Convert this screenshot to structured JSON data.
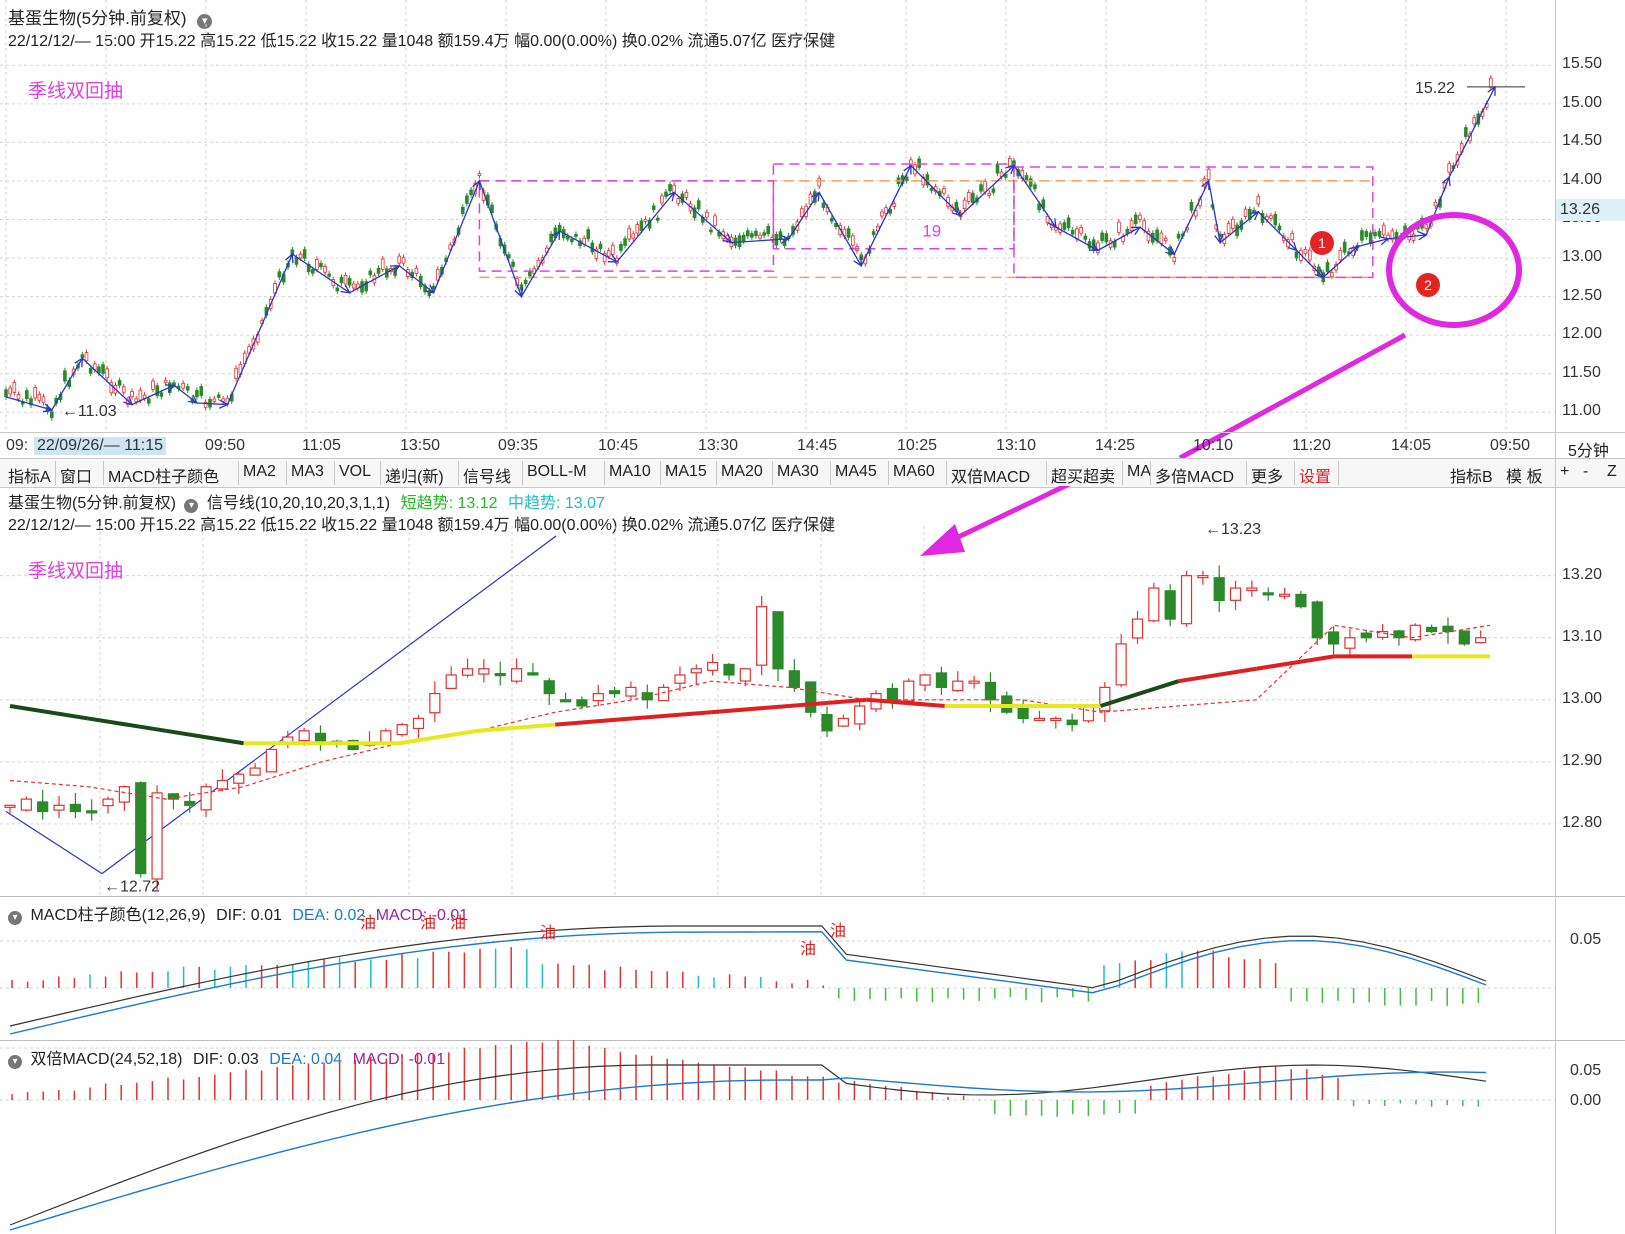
{
  "top_panel": {
    "title": "基蛋生物(5分钟.前复权)",
    "info": "22/12/12/— 15:00 开15.22 高15.22 低15.22 收15.22 量1048 额159.4万 幅0.00(0.00%) 换0.02% 流通5.07亿 医疗保健",
    "annotation": "季线双回抽",
    "high_label": "15.22",
    "low_label": "11.03",
    "count_label": "19",
    "marker1": "1",
    "marker2": "2",
    "price_tag": "13.26",
    "y_ticks": [
      "15.50",
      "15.00",
      "14.50",
      "14.00",
      "13.50",
      "13.00",
      "12.50",
      "12.00",
      "11.50",
      "11.00"
    ],
    "y_values": [
      15.5,
      15.0,
      14.5,
      14.0,
      13.5,
      13.0,
      12.5,
      12.0,
      11.5,
      11.0
    ]
  },
  "time_axis": {
    "labels": [
      "09:",
      "22/09/26/— 11:15",
      "09:50",
      "11:05",
      "13:50",
      "09:35",
      "10:45",
      "13:30",
      "14:45",
      "10:25",
      "13:10",
      "14:25",
      "10:10",
      "11:20",
      "14:05",
      "09:50"
    ],
    "period": "5分钟"
  },
  "toolbar": {
    "tabs": [
      "指标A",
      "窗口",
      "MACD柱子颜色",
      "MA2",
      "MA3",
      "VOL",
      "递归(新)",
      "信号线",
      "BOLL-M",
      "MA10",
      "MA15",
      "MA20",
      "MA30",
      "MA45",
      "MA60",
      "双倍MACD",
      "超买超卖",
      "MA",
      "多倍MACD",
      "更多",
      "设置"
    ],
    "right_tabs": [
      "指标B",
      "模 板",
      "+",
      "-",
      "Z"
    ]
  },
  "middle_panel": {
    "title": "基蛋生物(5分钟.前复权)",
    "indicator": "信号线(10,20,10,20,3,1,1)",
    "short_trend": "短趋势: 13.12",
    "mid_trend": "中趋势: 13.07",
    "info": "22/12/12/— 15:00 开15.22 高15.22 低15.22 收15.22 量1048 额159.4万 幅0.00(0.00%) 换0.02% 流通5.07亿 医疗保健",
    "annotation": "季线双回抽",
    "high_label": "13.23",
    "low_label": "12.72",
    "y_ticks": [
      "13.20",
      "13.10",
      "13.00",
      "12.90",
      "12.80"
    ],
    "y_values": [
      13.2,
      13.1,
      13.0,
      12.9,
      12.8
    ]
  },
  "macd_panel": {
    "title": "MACD柱子颜色(12,26,9)",
    "dif": "DIF: 0.01",
    "dea": "DEA: 0.02",
    "macd": "MACD: -0.01",
    "y_ticks": [
      "0.05"
    ],
    "oil_labels": [
      "油",
      "油",
      "油",
      "油",
      "油",
      "油"
    ]
  },
  "double_macd_panel": {
    "title": "双倍MACD(24,52,18)",
    "dif": "DIF: 0.03",
    "dea": "DEA: 0.04",
    "macd": "MACD: -0.01",
    "y_ticks": [
      "0.05",
      "0.00"
    ]
  },
  "chart_data": [
    {
      "type": "line",
      "title": "基蛋生物(5分钟.前复权)",
      "series": [
        {
          "name": "",
          "x_index": [
            0,
            12,
            20,
            33,
            44,
            50,
            58,
            75,
            90,
            103,
            112,
            124,
            135,
            145,
            160,
            175,
            190,
            205,
            213,
            224,
            237,
            250,
            264,
            275,
            286,
            297,
            306,
            315,
            318,
            328,
            338,
            345,
            354,
            362,
            372,
            378,
            390
          ],
          "values": [
            11.2,
            11.03,
            11.7,
            11.1,
            11.35,
            11.12,
            11.1,
            13.05,
            12.55,
            12.9,
            12.55,
            14.0,
            12.5,
            13.35,
            12.95,
            13.85,
            13.2,
            13.25,
            13.85,
            12.9,
            14.2,
            13.55,
            14.2,
            13.4,
            13.1,
            13.4,
            13.05,
            14.0,
            13.2,
            13.6,
            13.1,
            12.75,
            13.15,
            13.25,
            13.3,
            14.05,
            15.22
          ]
        }
      ],
      "xlim": [
        0,
        390
      ],
      "ylim": [
        10.9,
        15.62
      ],
      "grid": true
    },
    {
      "type": "candlestick",
      "title": "基蛋生物(5分钟.前复权)",
      "ylim": [
        12.7,
        13.28
      ],
      "series": [
        {
          "name": "短趋势",
          "values_sampled": [
            12.87,
            12.86,
            12.84,
            12.86,
            12.9,
            12.93,
            12.95,
            12.98,
            13.0,
            13.03,
            13.02,
            13.0,
            13.0,
            13.0,
            12.98,
            12.99,
            13.0,
            13.12,
            13.1,
            13.12
          ]
        },
        {
          "name": "中趋势",
          "values_sampled": [
            12.99,
            12.97,
            12.95,
            12.93,
            12.93,
            12.93,
            12.95,
            12.96,
            12.97,
            12.98,
            12.99,
            13.0,
            12.99,
            12.99,
            12.99,
            13.03,
            13.05,
            13.07,
            13.07,
            13.07
          ]
        }
      ]
    }
  ],
  "colors": {
    "up": "#e83030",
    "down": "#2a8a2a",
    "zigzag": "#2a35c8",
    "box": "#e040e0",
    "orange": "#f0a060"
  }
}
